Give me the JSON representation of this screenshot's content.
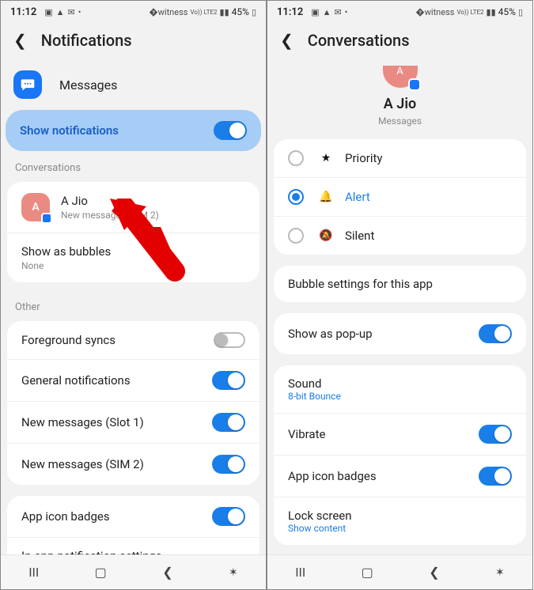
{
  "statusbar": {
    "time": "11:12",
    "battery": "45%",
    "net": "Vo)) LTE2"
  },
  "left": {
    "header_title": "Notifications",
    "app_name": "Messages",
    "show_notifications": "Show notifications",
    "sections": {
      "conversations": "Conversations",
      "other": "Other"
    },
    "conversation": {
      "name": "A Jio",
      "sub": "New messages (SIM 2)"
    },
    "show_bubbles": {
      "label": "Show as bubbles",
      "sub": "None"
    },
    "other_items": [
      {
        "label": "Foreground syncs",
        "on": false
      },
      {
        "label": "General notifications",
        "on": true
      },
      {
        "label": "New messages (Slot 1)",
        "on": true
      },
      {
        "label": "New messages (SIM 2)",
        "on": true
      }
    ],
    "badge_row": "App icon badges",
    "inapp_row": "In-app notification settings"
  },
  "right": {
    "header_title": "Conversations",
    "hero": {
      "name": "A Jio",
      "sub": "Messages"
    },
    "options": [
      {
        "label": "Priority",
        "selected": false,
        "icon": "star"
      },
      {
        "label": "Alert",
        "selected": true,
        "icon": "bell"
      },
      {
        "label": "Silent",
        "selected": false,
        "icon": "bell-off"
      }
    ],
    "bubble_settings": "Bubble settings for this app",
    "popup": "Show as pop-up",
    "sound": {
      "label": "Sound",
      "value": "8-bit Bounce"
    },
    "vibrate": "Vibrate",
    "badges": "App icon badges",
    "lock": {
      "label": "Lock screen",
      "value": "Show content"
    }
  }
}
